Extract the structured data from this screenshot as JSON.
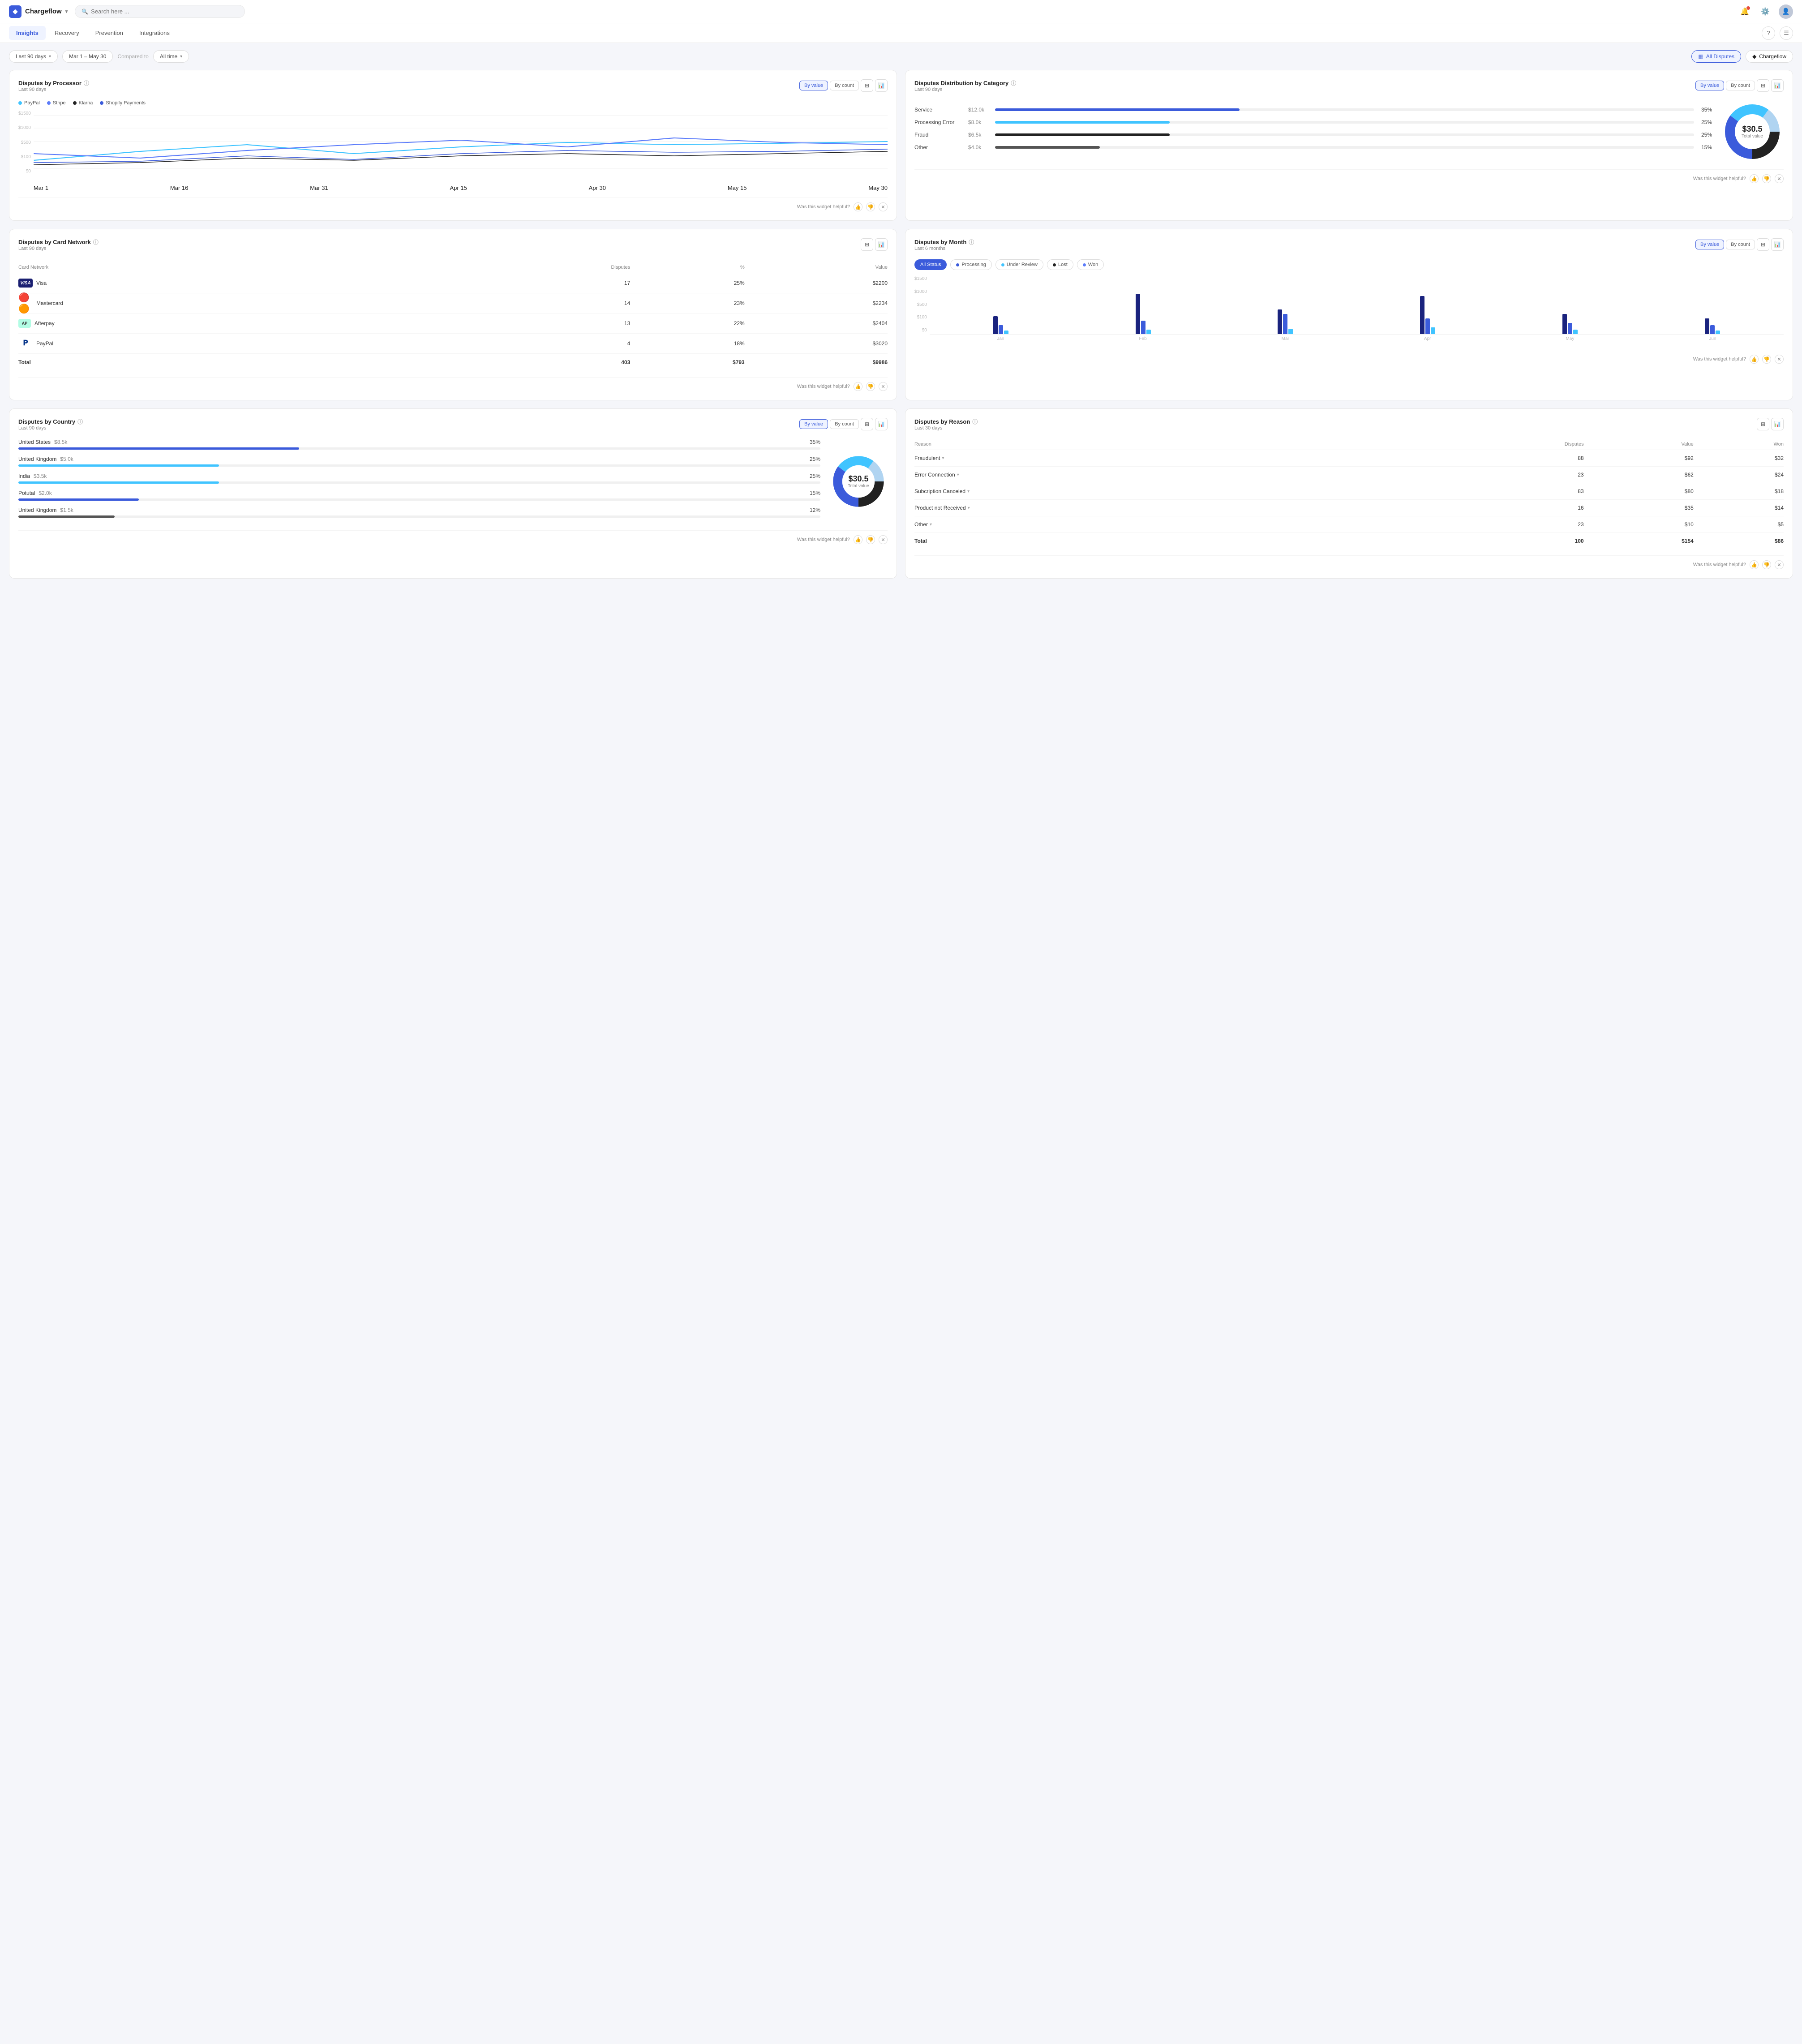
{
  "app": {
    "name": "Chargeflow",
    "logo_symbol": "◆",
    "search_placeholder": "Search here ..."
  },
  "nav": {
    "items": [
      "Insights",
      "Recovery",
      "Prevention",
      "Integrations"
    ],
    "active": "Insights",
    "help_label": "?",
    "menu_label": "☰"
  },
  "filters": {
    "period": "Last 90 days",
    "date_range": "Mar 1 – May 30",
    "compared_to": "Compared to",
    "compare_period": "All time",
    "all_disputes_label": "All Disputes",
    "chargeflow_label": "Chargeflow"
  },
  "disputes_by_processor": {
    "title": "Disputes by Processor",
    "subtitle": "Last 90 days",
    "by_value": "By value",
    "by_count": "By count",
    "legend": [
      {
        "label": "PayPal",
        "color": "#40c4ff"
      },
      {
        "label": "Stripe",
        "color": "#5c7cfa"
      },
      {
        "label": "Klarna",
        "color": "#222"
      },
      {
        "label": "Shopify Payments",
        "color": "#3b5bdb"
      }
    ],
    "y_labels": [
      "$1500",
      "$1000",
      "$500",
      "$100",
      "$0"
    ],
    "x_labels": [
      "Mar 1",
      "Mar 16",
      "Mar 31",
      "Apr 15",
      "Apr 30",
      "May 15",
      "May 30"
    ],
    "helpful_label": "Was this widget helpful?"
  },
  "disputes_distribution": {
    "title": "Disputes Distribution by Category",
    "subtitle": "Last 90 days",
    "by_value": "By value",
    "by_count": "By count",
    "categories": [
      {
        "label": "Service",
        "value": "$12.0k",
        "pct": 35,
        "color": "#3b5bdb"
      },
      {
        "label": "Processing Error",
        "value": "$8.0k",
        "pct": 25,
        "color": "#40c4ff"
      },
      {
        "label": "Fraud",
        "value": "$6.5k",
        "pct": 25,
        "color": "#222"
      },
      {
        "label": "Other",
        "value": "$4.0k",
        "pct": 15,
        "color": "#555"
      }
    ],
    "donut": {
      "total": "$30.5",
      "label": "Total value",
      "segments": [
        {
          "color": "#3b5bdb",
          "pct": 35
        },
        {
          "color": "#1c97d5",
          "pct": 25
        },
        {
          "color": "#222",
          "pct": 25
        },
        {
          "color": "#b0c4de",
          "pct": 15
        }
      ]
    },
    "helpful_label": "Was this widget helpful?"
  },
  "disputes_by_card_network": {
    "title": "Disputes by Card Network",
    "subtitle": "Last 90 days",
    "col_network": "Card Network",
    "col_disputes": "Disputes",
    "col_pct": "%",
    "col_value": "Value",
    "rows": [
      {
        "name": "Visa",
        "logo": "VISA",
        "type": "visa",
        "disputes": 17,
        "pct": "25%",
        "value": "$2200"
      },
      {
        "name": "Mastercard",
        "logo": "MC",
        "type": "mc",
        "disputes": 14,
        "pct": "23%",
        "value": "$2234"
      },
      {
        "name": "Afterpay",
        "logo": "AP",
        "type": "afterpay",
        "disputes": 13,
        "pct": "22%",
        "value": "$2404"
      },
      {
        "name": "PayPal",
        "logo": "P",
        "type": "paypal",
        "disputes": 4,
        "pct": "18%",
        "value": "$3020"
      }
    ],
    "total_label": "Total",
    "total_disputes": 403,
    "total_pct": "$793",
    "total_value": "$9986",
    "helpful_label": "Was this widget helpful?"
  },
  "disputes_by_month": {
    "title": "Disputes by Month",
    "subtitle": "Last 6 months",
    "by_value": "By value",
    "by_count": "By count",
    "status_filters": [
      "All Status",
      "Processing",
      "Under Review",
      "Lost",
      "Won"
    ],
    "active_status": "All Status",
    "status_colors": {
      "Processing": "#3b5bdb",
      "Under Review": "#40c4ff",
      "Lost": "#222",
      "Won": "#5c7cfa"
    },
    "y_labels": [
      "$1500",
      "$1000",
      "$500",
      "$100",
      "$0"
    ],
    "x_labels": [
      "Jan",
      "Feb",
      "Mar",
      "Apr",
      "May",
      "Jun"
    ],
    "helpful_label": "Was this widget helpful?"
  },
  "disputes_by_country": {
    "title": "Disputes by Country",
    "subtitle": "Last 90 days",
    "by_value": "By value",
    "by_count": "By count",
    "countries": [
      {
        "name": "United States",
        "value": "$8.5k",
        "pct": 35,
        "pct_label": "35%",
        "color": "#3b5bdb"
      },
      {
        "name": "United Kingdom",
        "value": "$5.0k",
        "pct": 25,
        "pct_label": "25%",
        "color": "#40c4ff"
      },
      {
        "name": "India",
        "value": "$3.5k",
        "pct": 25,
        "pct_label": "25%",
        "color": "#40c4ff"
      },
      {
        "name": "Potutal",
        "value": "$2.0k",
        "pct": 15,
        "pct_label": "15%",
        "color": "#3b5bdb"
      },
      {
        "name": "United Kingdom",
        "value": "$1.5k",
        "pct": 12,
        "pct_label": "12%",
        "color": "#555"
      }
    ],
    "donut": {
      "total": "$30.5",
      "label": "Total value"
    },
    "helpful_label": "Was this widget helpful?"
  },
  "disputes_by_reason": {
    "title": "Disputes by Reason",
    "subtitle": "Last 30 days",
    "col_reason": "Reason",
    "col_disputes": "Disputes",
    "col_value": "Value",
    "col_won": "Won",
    "rows": [
      {
        "reason": "Fraudulent",
        "disputes": 88,
        "value": "$92",
        "won": "$32"
      },
      {
        "reason": "Error Connection",
        "disputes": 23,
        "value": "$62",
        "won": "$24"
      },
      {
        "reason": "Subcription Canceled",
        "disputes": 83,
        "value": "$80",
        "won": "$18"
      },
      {
        "reason": "Product not Received",
        "disputes": 16,
        "value": "$35",
        "won": "$14"
      },
      {
        "reason": "Other",
        "disputes": 23,
        "value": "$10",
        "won": "$5"
      }
    ],
    "total_label": "Total",
    "total_disputes": 100,
    "total_value": "$154",
    "total_won": "$86",
    "helpful_label": "Was this widget helpful?"
  }
}
